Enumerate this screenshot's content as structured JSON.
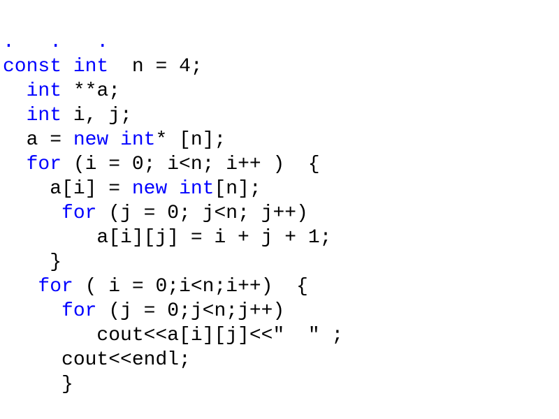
{
  "kw": {
    "const": "const",
    "int": "int",
    "new": "new",
    "for": "for"
  },
  "sym": {
    "dots": ".   .   .",
    "sp4": "    ",
    "sp2": "  ",
    "sp3": "   ",
    "sp5": "     ",
    "sp6": "      ",
    "sp8": "        "
  },
  "ln": {
    "l2_a": "  n = 4;",
    "l3_a": " **a;",
    "l4_a": " i, j;",
    "l5_a": "a = ",
    "l5_b": "* [n];",
    "l6_a": " (i = 0; i<n; i++ )  {",
    "l7_a": "a[i] = ",
    "l7_b": "[n];",
    "l8_a": " (j = 0; j<n; j++)",
    "l9_a": "a[i][j] = i + j + 1;",
    "l10_a": "}",
    "l11_a": " ( i = 0;i<n;i++)  {",
    "l12_a": " (j = 0;j<n;j++)",
    "l13_a": "cout<<a[i][j]<<\"  \" ;",
    "l14_a": "cout<<endl;",
    "l15_a": "}"
  }
}
